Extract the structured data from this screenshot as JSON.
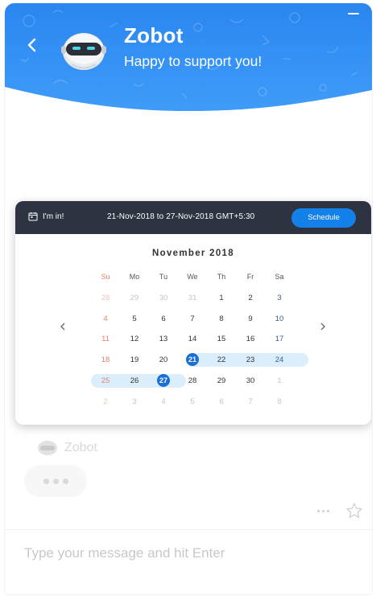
{
  "header": {
    "bot_name": "Zobot",
    "tagline": "Happy to support you!",
    "accent_color": "#2f8cf5"
  },
  "calendar": {
    "checkin_label": "I'm in!",
    "range_text": "21-Nov-2018 to 27-Nov-2018 GMT+5:30",
    "schedule_label": "Schedule",
    "month_title": "November 2018",
    "weekdays": [
      "Su",
      "Mo",
      "Tu",
      "We",
      "Th",
      "Fr",
      "Sa"
    ],
    "weeks": [
      [
        "28",
        "29",
        "30",
        "31",
        "1",
        "2",
        "3"
      ],
      [
        "4",
        "5",
        "6",
        "7",
        "8",
        "9",
        "10"
      ],
      [
        "11",
        "12",
        "13",
        "14",
        "15",
        "16",
        "17"
      ],
      [
        "18",
        "19",
        "20",
        "21",
        "22",
        "23",
        "24"
      ],
      [
        "25",
        "26",
        "27",
        "28",
        "29",
        "30",
        "1"
      ],
      [
        "2",
        "3",
        "4",
        "5",
        "6",
        "7",
        "8"
      ]
    ],
    "selected_start": "21",
    "selected_end": "27"
  },
  "chat": {
    "typing_name": "Zobot",
    "input_placeholder": "Type your message and hit Enter"
  },
  "icons": {
    "back": "chevron-left-icon",
    "minimize": "minimize-icon",
    "calendar": "calendar-icon",
    "prev": "chevron-left-icon",
    "next": "chevron-right-icon",
    "more": "more-dots-icon",
    "star": "star-icon"
  }
}
